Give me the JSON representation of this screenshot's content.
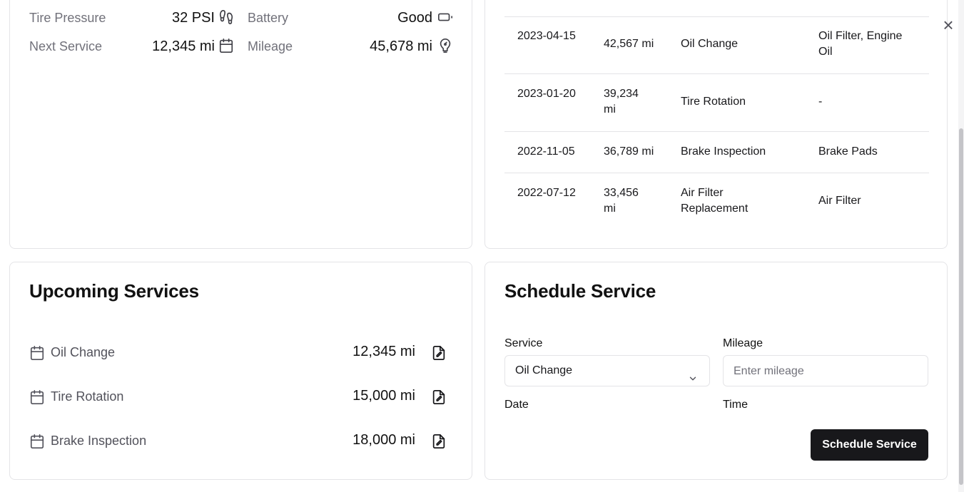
{
  "status": {
    "items": [
      {
        "label": "Tire Pressure",
        "value": "32 PSI",
        "icon": "footprints-icon"
      },
      {
        "label": "Battery",
        "value": "Good",
        "icon": "battery-icon"
      },
      {
        "label": "Next Service",
        "value": "12,345 mi",
        "icon": "calendar-icon"
      },
      {
        "label": "Mileage",
        "value": "45,678 mi",
        "icon": "gauge-icon"
      }
    ]
  },
  "history": {
    "rows": [
      {
        "date": "2023-04-15",
        "mileage": "42,567 mi",
        "type": "Oil Change",
        "parts": "Oil Filter, Engine Oil"
      },
      {
        "date": "2023-01-20",
        "mileage": "39,234 mi",
        "type": "Tire Rotation",
        "parts": "-"
      },
      {
        "date": "2022-11-05",
        "mileage": "36,789 mi",
        "type": "Brake Inspection",
        "parts": "Brake Pads"
      },
      {
        "date": "2022-07-12",
        "mileage": "33,456 mi",
        "type": "Air Filter Replacement",
        "parts": "Air Filter"
      }
    ]
  },
  "upcoming": {
    "title": "Upcoming Services",
    "items": [
      {
        "name": "Oil Change",
        "mileage": "12,345 mi"
      },
      {
        "name": "Tire Rotation",
        "mileage": "15,000 mi"
      },
      {
        "name": "Brake Inspection",
        "mileage": "18,000 mi"
      }
    ]
  },
  "schedule": {
    "title": "Schedule Service",
    "service_label": "Service",
    "service_value": "Oil Change",
    "mileage_label": "Mileage",
    "mileage_placeholder": "Enter mileage",
    "date_label": "Date",
    "time_label": "Time",
    "submit_label": "Schedule Service"
  },
  "close_glyph": "×"
}
